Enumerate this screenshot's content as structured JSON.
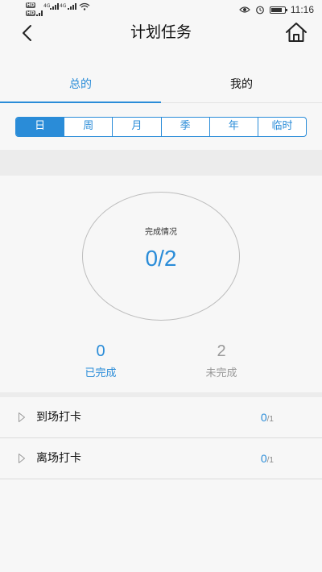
{
  "status_bar": {
    "hd1": "HD",
    "net1": "4G",
    "net2": "4G",
    "hd2": "HD",
    "time": "11:16"
  },
  "header": {
    "title": "计划任务",
    "back_icon": "chevron-left-icon",
    "home_icon": "home-icon"
  },
  "main_tabs": [
    {
      "label": "总的",
      "active": true
    },
    {
      "label": "我的",
      "active": false
    }
  ],
  "periods": [
    {
      "label": "日",
      "active": true
    },
    {
      "label": "周",
      "active": false
    },
    {
      "label": "月",
      "active": false
    },
    {
      "label": "季",
      "active": false
    },
    {
      "label": "年",
      "active": false
    },
    {
      "label": "临时",
      "active": false
    }
  ],
  "summary": {
    "label": "完成情况",
    "value": "0/2",
    "completed_count": "0",
    "completed_label": "已完成",
    "incomplete_count": "2",
    "incomplete_label": "未完成"
  },
  "tasks": [
    {
      "name": "到场打卡",
      "done": "0",
      "total": "/1"
    },
    {
      "name": "离场打卡",
      "done": "0",
      "total": "/1"
    }
  ],
  "colors": {
    "accent": "#2a8cd8",
    "muted": "#999999",
    "background": "#f7f7f7"
  }
}
